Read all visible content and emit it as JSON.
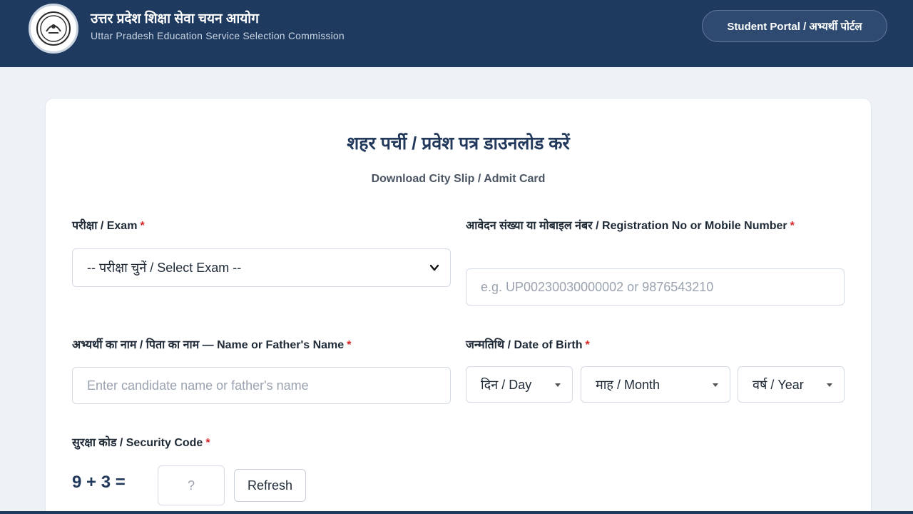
{
  "header": {
    "org_name_hindi": "उत्तर प्रदेश शिक्षा सेवा चयन आयोग",
    "org_name_english": "Uttar Pradesh Education Service Selection Commission",
    "portal_button_label": "Student Portal / अभ्यर्थी पोर्टल",
    "logo_icon": "emblem-seal-icon",
    "brand_color": "#1f3a5f"
  },
  "form": {
    "title_hindi": "शहर पर्ची / प्रवेश पत्र डाउनलोड करें",
    "title_english": "Download City Slip / Admit Card",
    "required_marker": "*",
    "exam": {
      "label": "परीक्षा / Exam",
      "selected": "-- परीक्षा चुनें / Select Exam --"
    },
    "registration": {
      "label": "आवेदन संख्या या मोबाइल नंबर / Registration No or Mobile Number",
      "placeholder": "e.g. UP00230030000002 or 9876543210",
      "value": ""
    },
    "name": {
      "label": "अभ्यर्थी का नाम / पिता का नाम — Name or Father's Name",
      "placeholder": "Enter candidate name or father's name",
      "value": ""
    },
    "dob": {
      "label": "जन्मतिथि / Date of Birth",
      "day": "दिन / Day",
      "month": "माह / Month",
      "year": "वर्ष / Year"
    },
    "security": {
      "label": "सुरक्षा कोड / Security Code",
      "question": "9 + 3 =",
      "answer_placeholder": "?",
      "refresh_label": "Refresh"
    }
  },
  "colors": {
    "accent": "#22395c",
    "required": "#dc2626",
    "page_background": "#eef1f6"
  }
}
